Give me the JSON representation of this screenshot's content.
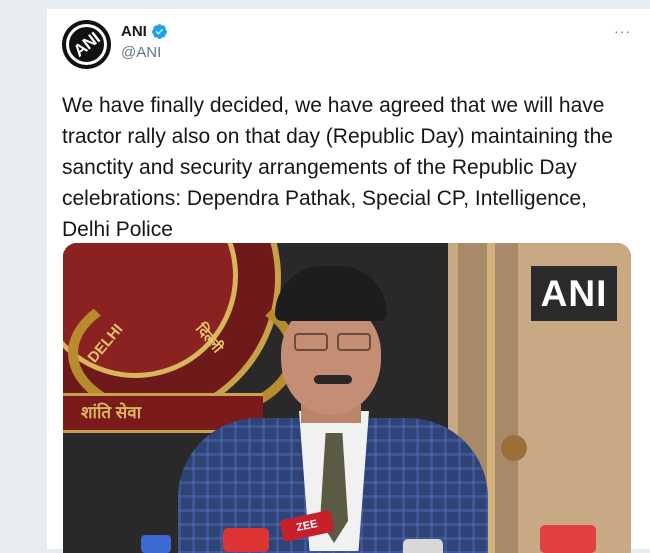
{
  "tweet": {
    "display_name": "ANI",
    "handle": "@ANI",
    "avatar_text": "ANI",
    "more_icon": "···",
    "verified": true,
    "text": "We have finally decided, we have agreed that we will have tractor rally also on that day (Republic Day) maintaining the sanctity and security arrangements of the Republic Day celebrations: Dependra Pathak, Special CP, Intelligence, Delhi Police"
  },
  "media": {
    "watermark": "ANI",
    "mic_label": "ZEE",
    "emblem_text_left": "DELHI",
    "emblem_text_right": "दिल्ली",
    "ribbon_text": "शांति  सेवा"
  },
  "colors": {
    "verified_blue": "#1da1f2",
    "text": "#14171a",
    "secondary": "#657786"
  }
}
